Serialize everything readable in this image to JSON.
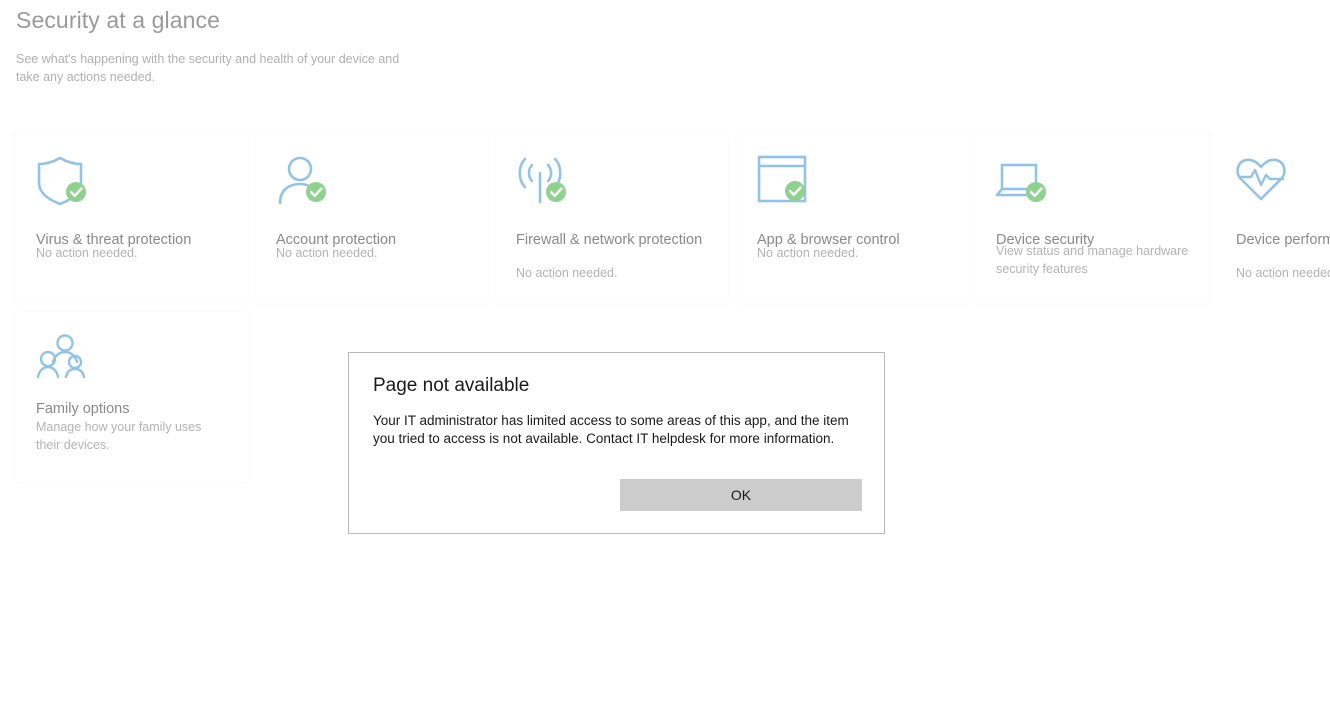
{
  "header": {
    "title": "Security at a glance",
    "subtitle": "See what's happening with the security and health of your device and take any actions needed."
  },
  "colors": {
    "icon_blue": "#92c3e6",
    "check_green": "#8fd18f",
    "dialog_button_gray": "#cccccc"
  },
  "tiles": [
    {
      "icon": "shield-icon",
      "title": "Virus & threat protection",
      "status": "No action needed."
    },
    {
      "icon": "person-icon",
      "title": "Account protection",
      "status": "No action needed."
    },
    {
      "icon": "wireless-antenna-icon",
      "title": "Firewall & network protection",
      "status": "No action needed."
    },
    {
      "icon": "browser-window-icon",
      "title": "App & browser control",
      "status": "No action needed."
    },
    {
      "icon": "laptop-icon",
      "title": "Device security",
      "status": "View status and manage hardware security features"
    },
    {
      "icon": "heart-pulse-icon",
      "title": "Device performance & health",
      "status": "No action needed."
    },
    {
      "icon": "family-icon",
      "title": "Family options",
      "status": "Manage how your family uses their devices."
    }
  ],
  "dialog": {
    "title": "Page not available",
    "body": "Your IT administrator has limited access to some areas of this app, and the item you tried to access is not available. Contact IT helpdesk for more information.",
    "ok_label": "OK"
  }
}
